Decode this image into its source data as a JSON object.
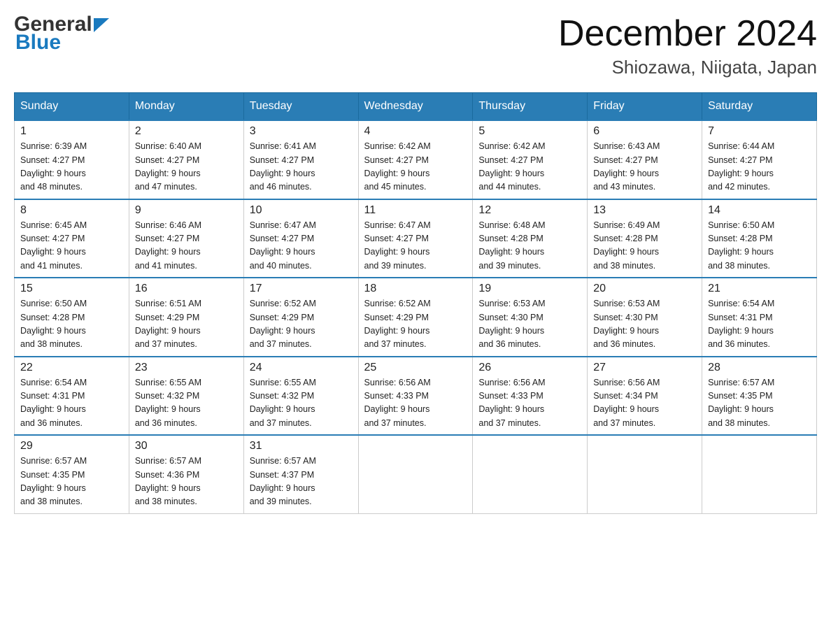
{
  "header": {
    "month_year": "December 2024",
    "location": "Shiozawa, Niigata, Japan",
    "logo_general": "General",
    "logo_blue": "Blue"
  },
  "days_of_week": [
    "Sunday",
    "Monday",
    "Tuesday",
    "Wednesday",
    "Thursday",
    "Friday",
    "Saturday"
  ],
  "weeks": [
    [
      {
        "day": "1",
        "sunrise": "6:39 AM",
        "sunset": "4:27 PM",
        "daylight": "9 hours and 48 minutes."
      },
      {
        "day": "2",
        "sunrise": "6:40 AM",
        "sunset": "4:27 PM",
        "daylight": "9 hours and 47 minutes."
      },
      {
        "day": "3",
        "sunrise": "6:41 AM",
        "sunset": "4:27 PM",
        "daylight": "9 hours and 46 minutes."
      },
      {
        "day": "4",
        "sunrise": "6:42 AM",
        "sunset": "4:27 PM",
        "daylight": "9 hours and 45 minutes."
      },
      {
        "day": "5",
        "sunrise": "6:42 AM",
        "sunset": "4:27 PM",
        "daylight": "9 hours and 44 minutes."
      },
      {
        "day": "6",
        "sunrise": "6:43 AM",
        "sunset": "4:27 PM",
        "daylight": "9 hours and 43 minutes."
      },
      {
        "day": "7",
        "sunrise": "6:44 AM",
        "sunset": "4:27 PM",
        "daylight": "9 hours and 42 minutes."
      }
    ],
    [
      {
        "day": "8",
        "sunrise": "6:45 AM",
        "sunset": "4:27 PM",
        "daylight": "9 hours and 41 minutes."
      },
      {
        "day": "9",
        "sunrise": "6:46 AM",
        "sunset": "4:27 PM",
        "daylight": "9 hours and 41 minutes."
      },
      {
        "day": "10",
        "sunrise": "6:47 AM",
        "sunset": "4:27 PM",
        "daylight": "9 hours and 40 minutes."
      },
      {
        "day": "11",
        "sunrise": "6:47 AM",
        "sunset": "4:27 PM",
        "daylight": "9 hours and 39 minutes."
      },
      {
        "day": "12",
        "sunrise": "6:48 AM",
        "sunset": "4:28 PM",
        "daylight": "9 hours and 39 minutes."
      },
      {
        "day": "13",
        "sunrise": "6:49 AM",
        "sunset": "4:28 PM",
        "daylight": "9 hours and 38 minutes."
      },
      {
        "day": "14",
        "sunrise": "6:50 AM",
        "sunset": "4:28 PM",
        "daylight": "9 hours and 38 minutes."
      }
    ],
    [
      {
        "day": "15",
        "sunrise": "6:50 AM",
        "sunset": "4:28 PM",
        "daylight": "9 hours and 38 minutes."
      },
      {
        "day": "16",
        "sunrise": "6:51 AM",
        "sunset": "4:29 PM",
        "daylight": "9 hours and 37 minutes."
      },
      {
        "day": "17",
        "sunrise": "6:52 AM",
        "sunset": "4:29 PM",
        "daylight": "9 hours and 37 minutes."
      },
      {
        "day": "18",
        "sunrise": "6:52 AM",
        "sunset": "4:29 PM",
        "daylight": "9 hours and 37 minutes."
      },
      {
        "day": "19",
        "sunrise": "6:53 AM",
        "sunset": "4:30 PM",
        "daylight": "9 hours and 36 minutes."
      },
      {
        "day": "20",
        "sunrise": "6:53 AM",
        "sunset": "4:30 PM",
        "daylight": "9 hours and 36 minutes."
      },
      {
        "day": "21",
        "sunrise": "6:54 AM",
        "sunset": "4:31 PM",
        "daylight": "9 hours and 36 minutes."
      }
    ],
    [
      {
        "day": "22",
        "sunrise": "6:54 AM",
        "sunset": "4:31 PM",
        "daylight": "9 hours and 36 minutes."
      },
      {
        "day": "23",
        "sunrise": "6:55 AM",
        "sunset": "4:32 PM",
        "daylight": "9 hours and 36 minutes."
      },
      {
        "day": "24",
        "sunrise": "6:55 AM",
        "sunset": "4:32 PM",
        "daylight": "9 hours and 37 minutes."
      },
      {
        "day": "25",
        "sunrise": "6:56 AM",
        "sunset": "4:33 PM",
        "daylight": "9 hours and 37 minutes."
      },
      {
        "day": "26",
        "sunrise": "6:56 AM",
        "sunset": "4:33 PM",
        "daylight": "9 hours and 37 minutes."
      },
      {
        "day": "27",
        "sunrise": "6:56 AM",
        "sunset": "4:34 PM",
        "daylight": "9 hours and 37 minutes."
      },
      {
        "day": "28",
        "sunrise": "6:57 AM",
        "sunset": "4:35 PM",
        "daylight": "9 hours and 38 minutes."
      }
    ],
    [
      {
        "day": "29",
        "sunrise": "6:57 AM",
        "sunset": "4:35 PM",
        "daylight": "9 hours and 38 minutes."
      },
      {
        "day": "30",
        "sunrise": "6:57 AM",
        "sunset": "4:36 PM",
        "daylight": "9 hours and 38 minutes."
      },
      {
        "day": "31",
        "sunrise": "6:57 AM",
        "sunset": "4:37 PM",
        "daylight": "9 hours and 39 minutes."
      },
      null,
      null,
      null,
      null
    ]
  ]
}
